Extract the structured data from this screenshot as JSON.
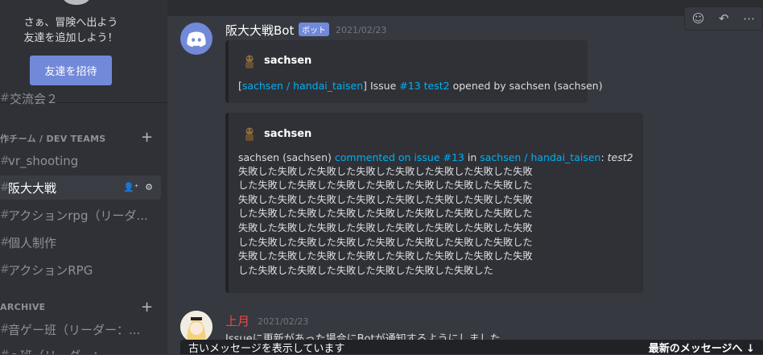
{
  "sidebar": {
    "invite_line1": "さぁ、冒険へ出よう",
    "invite_line2": "友達を追加しよう！",
    "invite_button": "友達を招待",
    "partial_channel": "交流会２",
    "category_dev": "作チーム / DEV TEAMS",
    "category_archive": "ARCHIVE",
    "channels": [
      {
        "label": "vr_shooting"
      },
      {
        "label": "阪大大戦",
        "active": true
      },
      {
        "label": "アクションrpg（リーダ..."
      },
      {
        "label": "個人制作"
      },
      {
        "label": "アクションRPG"
      }
    ],
    "archive_channels": [
      {
        "label": "音ゲー班（リーダー：..."
      },
      {
        "label": "ｏ班（リーダー：..."
      }
    ]
  },
  "messages": {
    "bot_name": "阪大大戦Bot",
    "bot_tag": "ボット",
    "bot_time": "2021/02/23",
    "embed1": {
      "author": "sachsen",
      "bracket_open": "[",
      "repo": "sachsen / handai_taisen",
      "bracket_close": "] Issue ",
      "issue": "#13 test2",
      "rest": " opened by sachsen (sachsen)"
    },
    "embed2": {
      "author": "sachsen",
      "prefix": "sachsen (sachsen) ",
      "commented": "commented on issue #13",
      "in": " in ",
      "repo": "sachsen / handai_taisen",
      "colon": ": ",
      "issue_title": "test2",
      "body_lines": [
        "失敗した失敗した失敗した失敗した失敗した失敗した失敗した失敗",
        "した失敗した失敗した失敗した失敗した失敗した失敗した失敗した",
        "失敗した失敗した失敗した失敗した失敗した失敗した失敗した失敗",
        "した失敗した失敗した失敗した失敗した失敗した失敗した失敗した",
        "失敗した失敗した失敗した失敗した失敗した失敗した失敗した失敗",
        "した失敗した失敗した失敗した失敗した失敗した失敗した失敗した",
        "失敗した失敗した失敗した失敗した失敗した失敗した失敗した失敗",
        "した失敗した失敗した失敗した失敗した失敗した失敗した"
      ]
    },
    "user2_name": "上月",
    "user2_time": "2021/02/23",
    "user2_text": "Issueに更新があった場合にBotが通知するようにしました。"
  },
  "bottom": {
    "old_messages": "古いメッセージを表示しています",
    "jump_latest": "最新のメッセージへ"
  },
  "colors": {
    "accent": "#7289da",
    "link": "#00b0f4",
    "user2": "#f04747"
  }
}
